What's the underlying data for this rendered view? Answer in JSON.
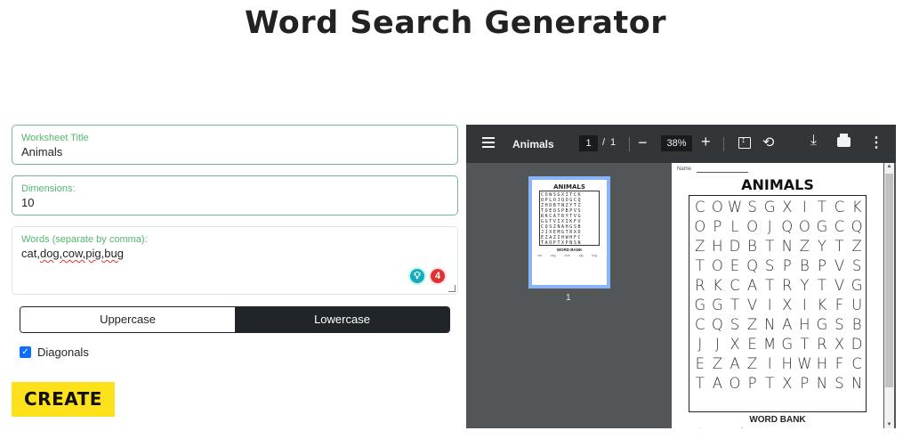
{
  "header": {
    "title": "Word Search Generator"
  },
  "form": {
    "worksheet_title": {
      "label": "Worksheet Title",
      "value": "Animals"
    },
    "dimensions": {
      "label": "Dimensions:",
      "value": "10"
    },
    "words": {
      "label": "Words (separate by comma):",
      "value_parts": [
        "cat,",
        "dog,cow,pig,bug"
      ]
    },
    "grammar_badges": {
      "suggestion_icon": "bulb-icon",
      "error_count": "4"
    },
    "case_options": {
      "uppercase": "Uppercase",
      "lowercase": "Lowercase",
      "selected": "Lowercase"
    },
    "diagonals": {
      "label": "Diagonals",
      "checked": true
    },
    "create_label": "CREATE",
    "accent_color": "#fde21b"
  },
  "viewer": {
    "doc_name": "Animals",
    "current_page": "1",
    "page_sep": "/",
    "total_pages": "1",
    "zoom": "38%",
    "thumbnail_page_number": "1",
    "sheet": {
      "name_label": "Name",
      "title": "ANIMALS",
      "grid": [
        "COWSGXITCK",
        "OPLOJQOGCQ",
        "ZHDBTNZYTZ",
        "TOEQSPBPVS",
        "RKCATRYTVG",
        "GGTVIXIKFU",
        "CQSZNAHGSB",
        "JJXEMGTRXD",
        "EZAZIHWHFC",
        "TAOPTXPNSN"
      ],
      "bank_title": "WORD BANK",
      "bank_words": [
        "cat",
        "dog",
        "cow",
        "pig",
        "bug"
      ]
    }
  }
}
